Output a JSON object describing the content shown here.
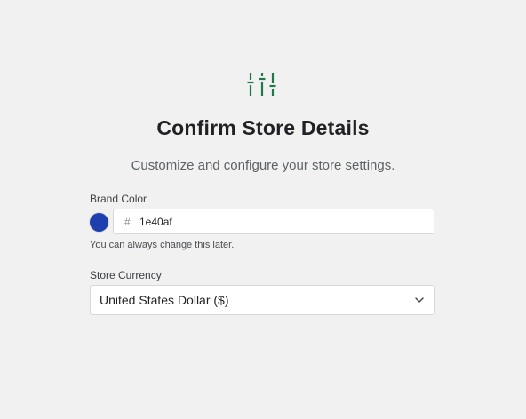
{
  "header": {
    "icon": "sliders-icon",
    "title": "Confirm Store Details",
    "subtitle": "Customize and configure your store settings."
  },
  "brand_color": {
    "label": "Brand Color",
    "swatch_color": "#1e40af",
    "prefix": "#",
    "value": "1e40af",
    "help": "You can always change this later."
  },
  "currency": {
    "label": "Store Currency",
    "selected": "United States Dollar ($)",
    "icon": "chevron-down-icon"
  },
  "colors": {
    "background": "#f1f1f1",
    "icon_accent": "#1e7b47"
  }
}
